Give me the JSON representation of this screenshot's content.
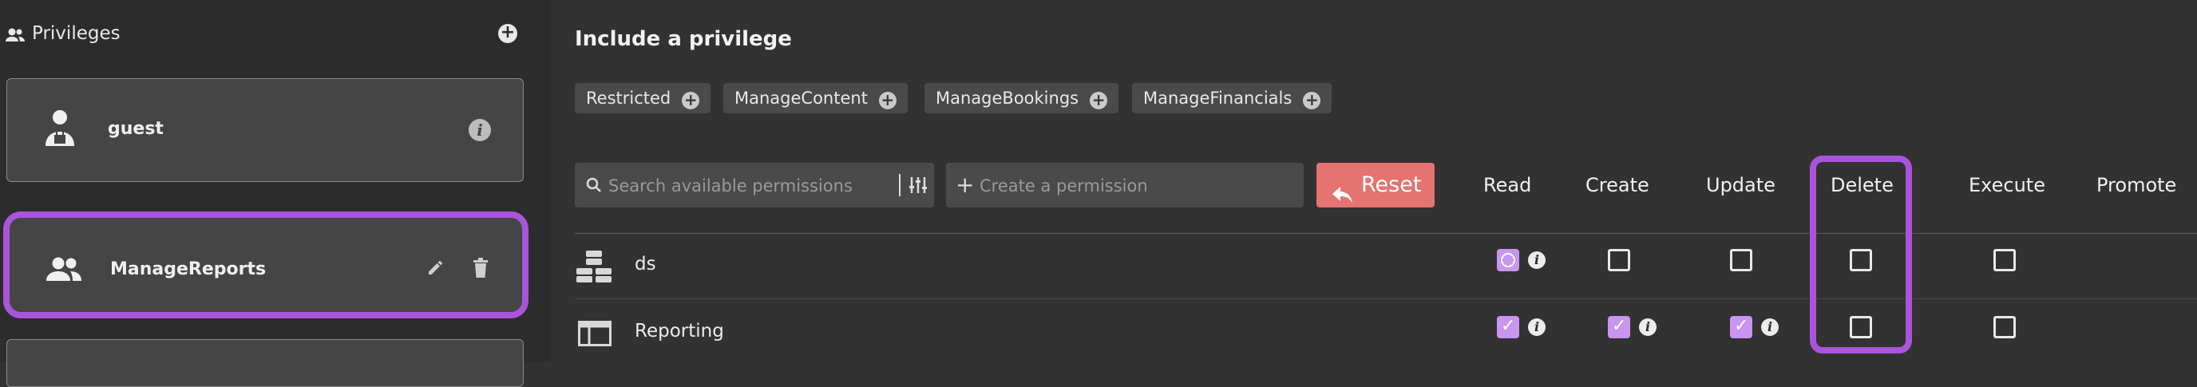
{
  "sidebar": {
    "title": "Privileges",
    "items": [
      {
        "label": "guest"
      },
      {
        "label": "ManageReports"
      }
    ]
  },
  "main": {
    "title": "Include a privilege",
    "chips": [
      "Restricted",
      "ManageContent",
      "ManageBookings",
      "ManageFinancials"
    ],
    "search": {
      "placeholder": "Search available permissions"
    },
    "create": {
      "placeholder": "Create a permission"
    },
    "reset_label": "Reset",
    "columns": [
      "Read",
      "Create",
      "Update",
      "Delete",
      "Execute",
      "Promote"
    ],
    "rows": [
      {
        "label": "ds",
        "icon": "datasource-stack-icon",
        "read": "partial",
        "create": "unchecked",
        "update": "unchecked",
        "delete": "unchecked",
        "execute": "unchecked"
      },
      {
        "label": "Reporting",
        "icon": "report-window-icon",
        "read": "checked",
        "create": "checked",
        "update": "checked",
        "delete": "unchecked",
        "execute": "unchecked"
      }
    ]
  },
  "colors": {
    "accent": "#a855dc",
    "checkbox_on": "#c995f0",
    "reset": "#e5736f"
  }
}
